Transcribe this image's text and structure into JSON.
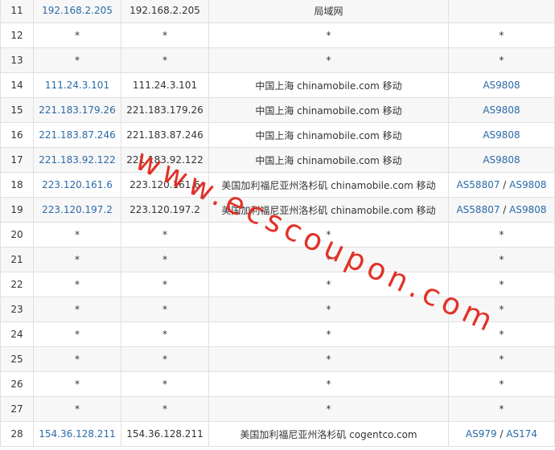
{
  "rows": [
    {
      "hop": "11",
      "ip": "192.168.2.205",
      "host": "192.168.2.205",
      "loc": "局域网",
      "as": []
    },
    {
      "hop": "12",
      "ip": "*",
      "host": "*",
      "loc": "*",
      "as": [
        "*"
      ]
    },
    {
      "hop": "13",
      "ip": "*",
      "host": "*",
      "loc": "*",
      "as": [
        "*"
      ]
    },
    {
      "hop": "14",
      "ip": "111.24.3.101",
      "host": "111.24.3.101",
      "loc": "中国上海 chinamobile.com 移动",
      "as": [
        "AS9808"
      ]
    },
    {
      "hop": "15",
      "ip": "221.183.179.26",
      "host": "221.183.179.26",
      "loc": "中国上海 chinamobile.com 移动",
      "as": [
        "AS9808"
      ]
    },
    {
      "hop": "16",
      "ip": "221.183.87.246",
      "host": "221.183.87.246",
      "loc": "中国上海 chinamobile.com 移动",
      "as": [
        "AS9808"
      ]
    },
    {
      "hop": "17",
      "ip": "221.183.92.122",
      "host": "221.183.92.122",
      "loc": "中国上海 chinamobile.com 移动",
      "as": [
        "AS9808"
      ]
    },
    {
      "hop": "18",
      "ip": "223.120.161.6",
      "host": "223.120.161.6",
      "loc": "美国加利福尼亚州洛杉矶 chinamobile.com 移动",
      "as": [
        "AS58807",
        "AS9808"
      ]
    },
    {
      "hop": "19",
      "ip": "223.120.197.2",
      "host": "223.120.197.2",
      "loc": "美国加利福尼亚州洛杉矶 chinamobile.com 移动",
      "as": [
        "AS58807",
        "AS9808"
      ]
    },
    {
      "hop": "20",
      "ip": "*",
      "host": "*",
      "loc": "*",
      "as": [
        "*"
      ]
    },
    {
      "hop": "21",
      "ip": "*",
      "host": "*",
      "loc": "*",
      "as": [
        "*"
      ]
    },
    {
      "hop": "22",
      "ip": "*",
      "host": "*",
      "loc": "*",
      "as": [
        "*"
      ]
    },
    {
      "hop": "23",
      "ip": "*",
      "host": "*",
      "loc": "*",
      "as": [
        "*"
      ]
    },
    {
      "hop": "24",
      "ip": "*",
      "host": "*",
      "loc": "*",
      "as": [
        "*"
      ]
    },
    {
      "hop": "25",
      "ip": "*",
      "host": "*",
      "loc": "*",
      "as": [
        "*"
      ]
    },
    {
      "hop": "26",
      "ip": "*",
      "host": "*",
      "loc": "*",
      "as": [
        "*"
      ]
    },
    {
      "hop": "27",
      "ip": "*",
      "host": "*",
      "loc": "*",
      "as": [
        "*"
      ]
    },
    {
      "hop": "28",
      "ip": "154.36.128.211",
      "host": "154.36.128.211",
      "loc": "美国加利福尼亚州洛杉矶 cogentco.com",
      "as": [
        "AS979",
        "AS174"
      ]
    }
  ],
  "as_separator": " / ",
  "watermark": "www.ecscoupon.com",
  "colors": {
    "link": "#2a6aa8",
    "text": "#333333",
    "stripe": "#f7f7f7",
    "border": "#e0e0e0",
    "watermark": "#e0281e"
  }
}
